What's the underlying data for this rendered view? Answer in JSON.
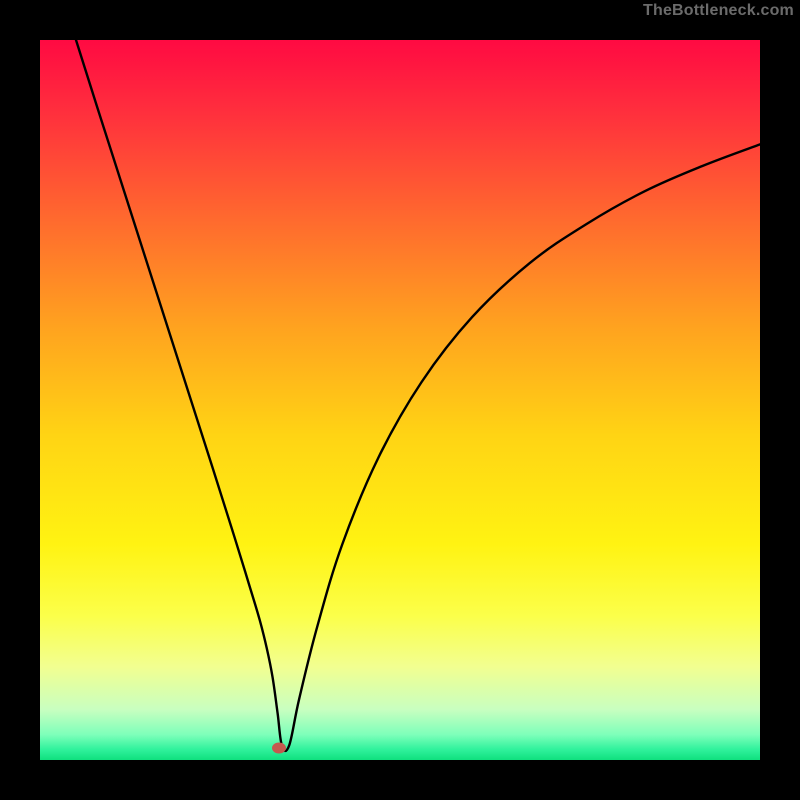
{
  "branding": {
    "watermark": "TheBottleneck.com"
  },
  "chart_data": {
    "type": "line",
    "title": "",
    "xlabel": "",
    "ylabel": "",
    "xlim": [
      0,
      100
    ],
    "ylim": [
      0,
      100
    ],
    "grid": false,
    "legend": null,
    "gradient_stops": [
      {
        "offset": 0.0,
        "color": "#ff0a42"
      },
      {
        "offset": 0.1,
        "color": "#ff2f3d"
      },
      {
        "offset": 0.25,
        "color": "#ff6a2e"
      },
      {
        "offset": 0.4,
        "color": "#ffa31f"
      },
      {
        "offset": 0.55,
        "color": "#ffd414"
      },
      {
        "offset": 0.7,
        "color": "#fff312"
      },
      {
        "offset": 0.8,
        "color": "#fbff4a"
      },
      {
        "offset": 0.87,
        "color": "#f2ff90"
      },
      {
        "offset": 0.93,
        "color": "#c8ffc0"
      },
      {
        "offset": 0.965,
        "color": "#7dffba"
      },
      {
        "offset": 0.985,
        "color": "#31f29d"
      },
      {
        "offset": 1.0,
        "color": "#0fe07e"
      }
    ],
    "series": [
      {
        "name": "bottleneck-curve",
        "stroke": "#000000",
        "stroke_width": 2.4,
        "x": [
          5,
          8,
          12,
          16,
          20,
          24,
          27,
          29,
          30.5,
          31.5,
          32.3,
          33.0,
          33.6,
          34.6,
          36.0,
          38.5,
          42,
          47,
          53,
          60,
          68,
          76,
          84,
          92,
          100
        ],
        "y": [
          100,
          90.5,
          78,
          65.5,
          53,
          40.5,
          31,
          24.5,
          19.5,
          15.5,
          11.5,
          6.5,
          2.0,
          2.0,
          8.5,
          18.5,
          30,
          42,
          52.5,
          61.5,
          69,
          74.5,
          79,
          82.5,
          85.5
        ]
      }
    ],
    "minimum_plateau": {
      "x_start": 33.0,
      "x_end": 34.6,
      "y": 2.0
    },
    "marker": {
      "name": "bottleneck-point",
      "x": 33.2,
      "y": 1.6,
      "color": "#c45a4e"
    }
  }
}
